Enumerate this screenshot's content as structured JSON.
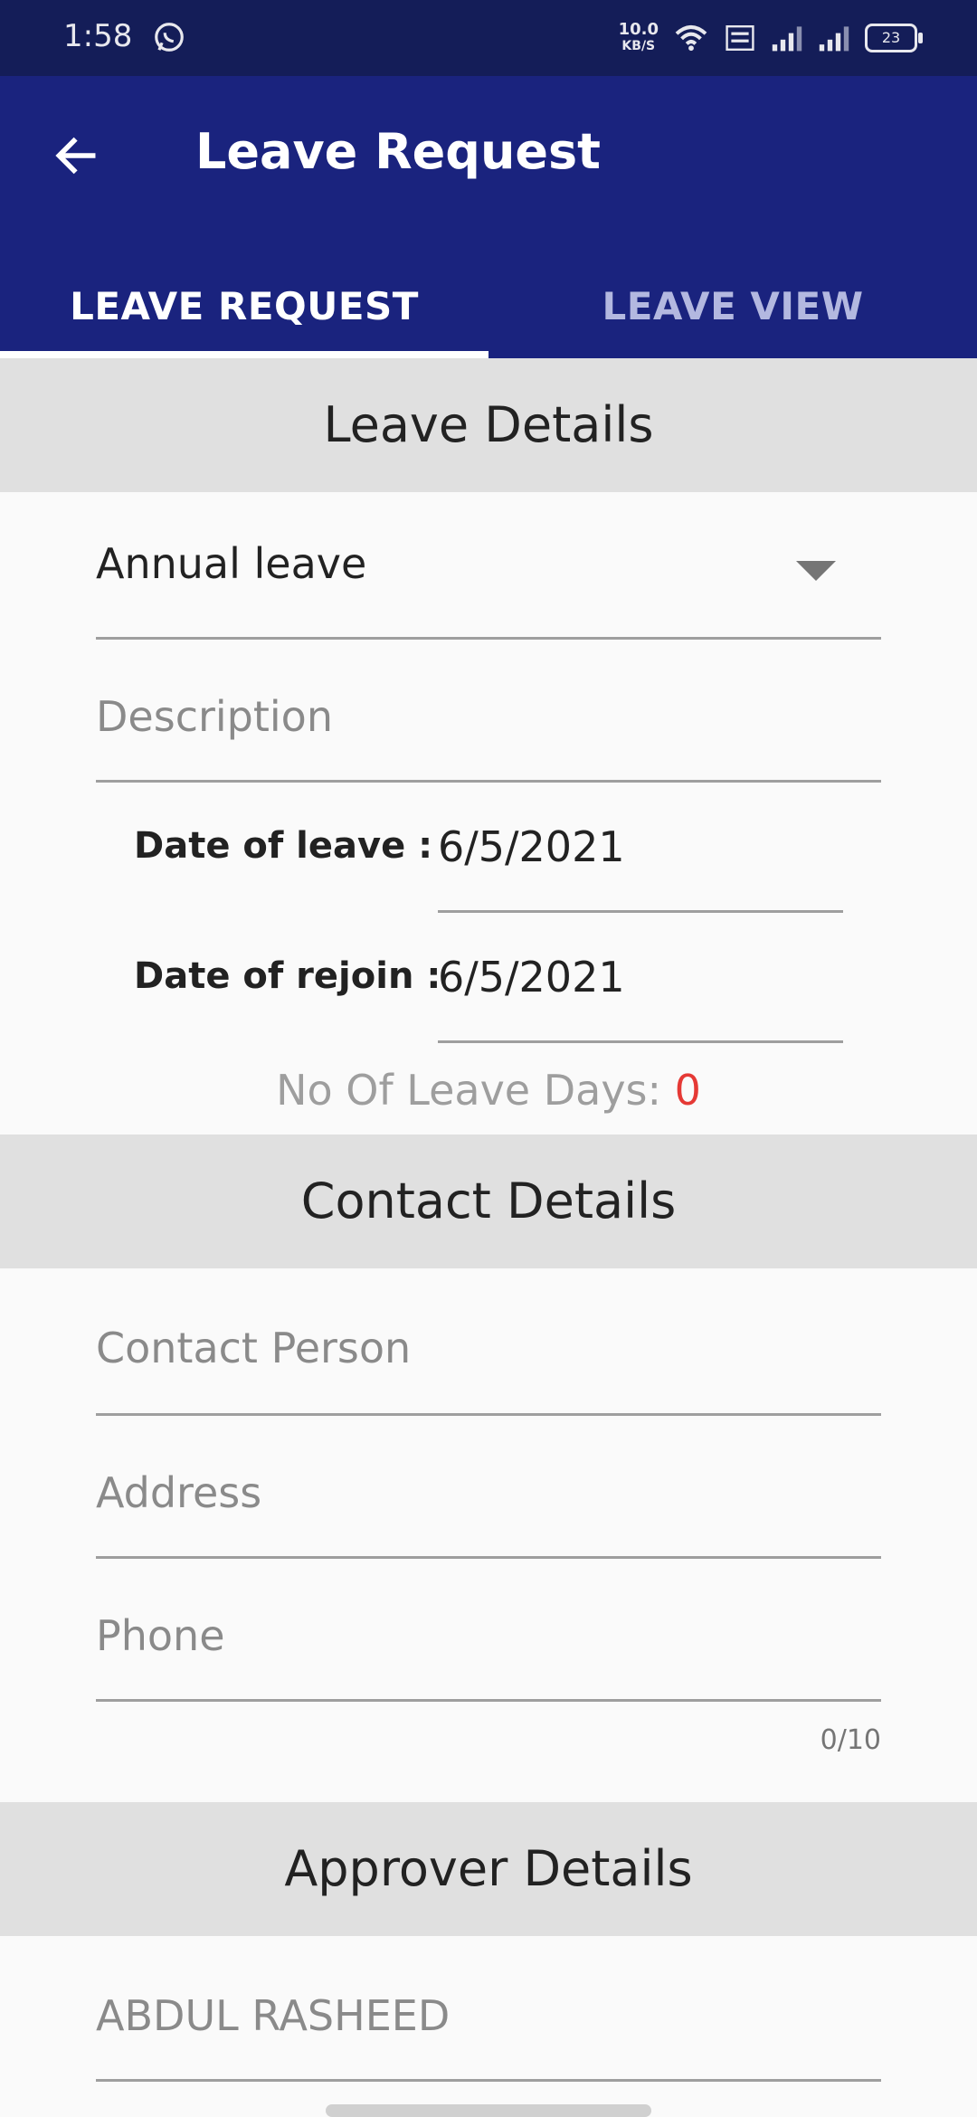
{
  "status_bar": {
    "time": "1:58",
    "speed_value": "10.0",
    "speed_unit": "KB/S",
    "battery": "23",
    "icons": [
      "whatsapp-icon",
      "wifi-icon",
      "volte-icon",
      "signal-icon",
      "signal-icon",
      "battery-icon"
    ]
  },
  "app_bar": {
    "title": "Leave Request",
    "back_icon": "arrow-left-icon",
    "color": "#1a237e"
  },
  "tabs": [
    {
      "label": "LEAVE REQUEST",
      "selected": true
    },
    {
      "label": "LEAVE VIEW",
      "selected": false
    }
  ],
  "leave_details": {
    "header": "Leave Details",
    "leave_type": "Annual leave",
    "description_placeholder": "Description",
    "date_of_leave_label": "Date of leave :",
    "date_of_leave": "6/5/2021",
    "date_of_rejoin_label": "Date of rejoin :",
    "date_of_rejoin": "6/5/2021",
    "no_of_days_label": "No Of Leave Days: ",
    "no_of_days": "0"
  },
  "contact_details": {
    "header": "Contact Details",
    "contact_person_placeholder": "Contact Person",
    "address_placeholder": "Address",
    "phone_placeholder": "Phone",
    "phone_counter": "0/10"
  },
  "approver_details": {
    "header": "Approver Details",
    "approver": "ABDUL RASHEED"
  }
}
